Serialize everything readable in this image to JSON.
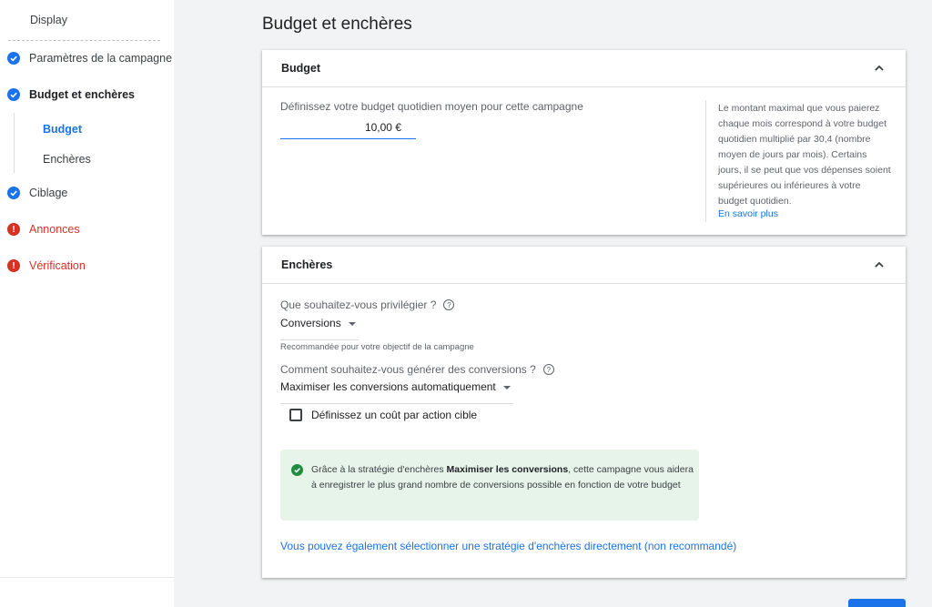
{
  "sidebar": {
    "display": "Display",
    "items": [
      {
        "label": "Paramètres de la campagne",
        "status": "check-circle-icon"
      },
      {
        "label": "Budget et enchères",
        "status": "check-circle-icon"
      },
      {
        "label": "Ciblage",
        "status": "check-circle-icon"
      },
      {
        "label": "Annonces",
        "status": "error-icon"
      },
      {
        "label": "Vérification",
        "status": "error-icon"
      }
    ],
    "subitems": [
      {
        "label": "Budget",
        "active": true
      },
      {
        "label": "Enchères",
        "active": false
      }
    ]
  },
  "page_title": "Budget et enchères",
  "budget_card": {
    "title": "Budget",
    "field_label": "Définissez votre budget quotidien moyen pour cette campagne",
    "budget_value": "10,00 €",
    "side_text": "Le montant maximal que vous paierez chaque mois correspond à votre budget quotidien multiplié par 30,4 (nombre moyen de jours par mois). Certains jours, il se peut que vos dépenses soient supérieures ou inférieures à votre budget quotidien.",
    "side_link": "En savoir plus"
  },
  "bid_card": {
    "title": "Enchères",
    "q1_label": "Que souhaitez-vous privilégier ?",
    "q1_value": "Conversions",
    "q1_hint": "Recommandée pour votre objectif de la campagne",
    "q2_label": "Comment souhaitez-vous générer des conversions ?",
    "q2_value": "Maximiser les conversions automatiquement",
    "checkbox_label": "Définissez un coût par action cible",
    "checkbox_checked": false,
    "info_prefix": "Grâce à la stratégie d'enchères ",
    "info_bold": "Maximiser les conversions",
    "info_suffix": ", cette campagne vous aidera à enregistrer le plus grand nombre de conversions possible en fonction de votre budget",
    "link": "Vous pouvez également sélectionner une stratégie d'enchères directement (non recommandé)"
  },
  "colors": {
    "accent": "#1a73e8",
    "error": "#d93025",
    "success": "#1e8e3e",
    "success_bg": "#e6f4ea"
  }
}
